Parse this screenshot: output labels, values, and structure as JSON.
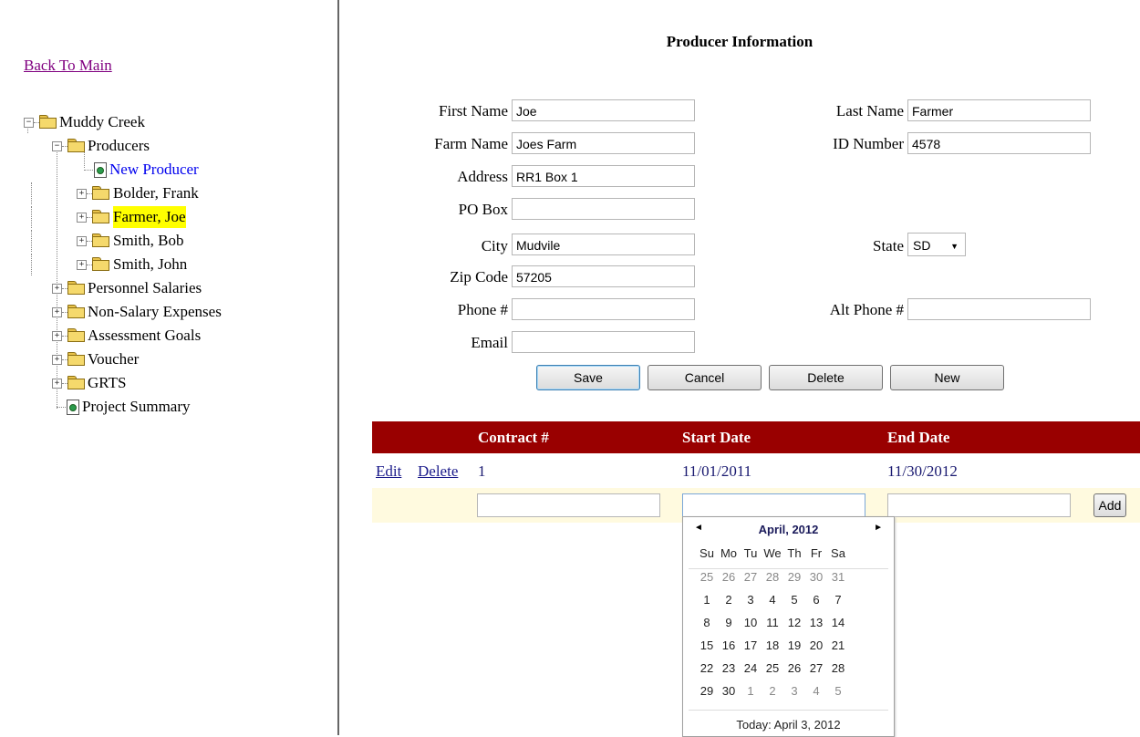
{
  "nav": {
    "back_label": "Back To Main"
  },
  "tree": {
    "root": "Muddy Creek",
    "producers": "Producers",
    "new_producer": "New Producer",
    "producer_items": [
      "Bolder, Frank",
      "Farmer, Joe",
      "Smith, Bob",
      "Smith, John"
    ],
    "sections": [
      "Personnel Salaries",
      "Non-Salary Expenses",
      "Assessment Goals",
      "Voucher",
      "GRTS"
    ],
    "project_summary": "Project Summary"
  },
  "form": {
    "title": "Producer Information",
    "labels": {
      "first_name": "First Name",
      "last_name": "Last Name",
      "farm_name": "Farm Name",
      "id_number": "ID Number",
      "address": "Address",
      "po_box": "PO Box",
      "city": "City",
      "state": "State",
      "zip": "Zip Code",
      "phone": "Phone #",
      "alt_phone": "Alt Phone #",
      "email": "Email"
    },
    "values": {
      "first_name": "Joe",
      "last_name": "Farmer",
      "farm_name": "Joes Farm",
      "id_number": "4578",
      "address": "RR1 Box 1",
      "po_box": "",
      "city": "Mudvile",
      "state": "SD",
      "zip": "57205",
      "phone": "",
      "alt_phone": "",
      "email": ""
    },
    "buttons": {
      "save": "Save",
      "cancel": "Cancel",
      "delete": "Delete",
      "new": "New"
    }
  },
  "contracts": {
    "headers": {
      "contract": "Contract #",
      "start": "Start Date",
      "end": "End Date"
    },
    "rows": [
      {
        "edit": "Edit",
        "delete": "Delete",
        "contract": "1",
        "start": "11/01/2011",
        "end": "11/30/2012"
      }
    ],
    "add_label": "Add"
  },
  "calendar": {
    "prev": "◄",
    "next": "►",
    "month": "April, 2012",
    "dow": [
      "Su",
      "Mo",
      "Tu",
      "We",
      "Th",
      "Fr",
      "Sa"
    ],
    "weeks": [
      [
        "25",
        "26",
        "27",
        "28",
        "29",
        "30",
        "31"
      ],
      [
        "1",
        "2",
        "3",
        "4",
        "5",
        "6",
        "7"
      ],
      [
        "8",
        "9",
        "10",
        "11",
        "12",
        "13",
        "14"
      ],
      [
        "15",
        "16",
        "17",
        "18",
        "19",
        "20",
        "21"
      ],
      [
        "22",
        "23",
        "24",
        "25",
        "26",
        "27",
        "28"
      ],
      [
        "29",
        "30",
        "1",
        "2",
        "3",
        "4",
        "5"
      ]
    ],
    "today": "Today: April 3, 2012"
  },
  "colors": {
    "header_bg": "#990000",
    "insert_row_bg": "#fffadf",
    "highlight": "#ffff00"
  }
}
